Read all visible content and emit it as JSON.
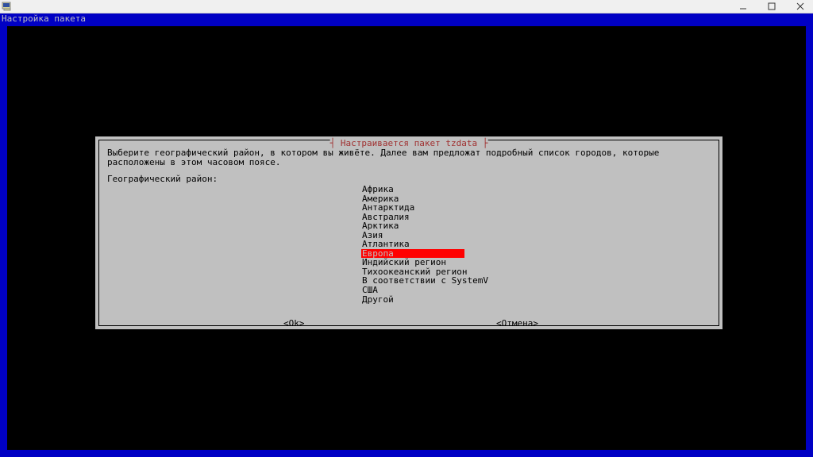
{
  "window": {
    "title_hint": "PuTTY"
  },
  "terminal": {
    "header": "Настройка пакета"
  },
  "dialog": {
    "title": "┤ Настраивается пакет tzdata ├",
    "instruction": "Выберите географический район, в котором вы живёте. Далее вам предложат подробный список городов, которые расположены в этом часовом поясе.",
    "field_label": "Географический район:",
    "options": [
      "Африка",
      "Америка",
      "Антарктида",
      "Австралия",
      "Арктика",
      "Азия",
      "Атлантика",
      "Европа",
      "Индийский регион",
      "Тихоокеанский регион",
      "В соответствии с SystemV",
      "США",
      "Другой"
    ],
    "selected_index": 7,
    "buttons": {
      "ok": "<Ok>",
      "cancel": "<Отмена>"
    }
  }
}
